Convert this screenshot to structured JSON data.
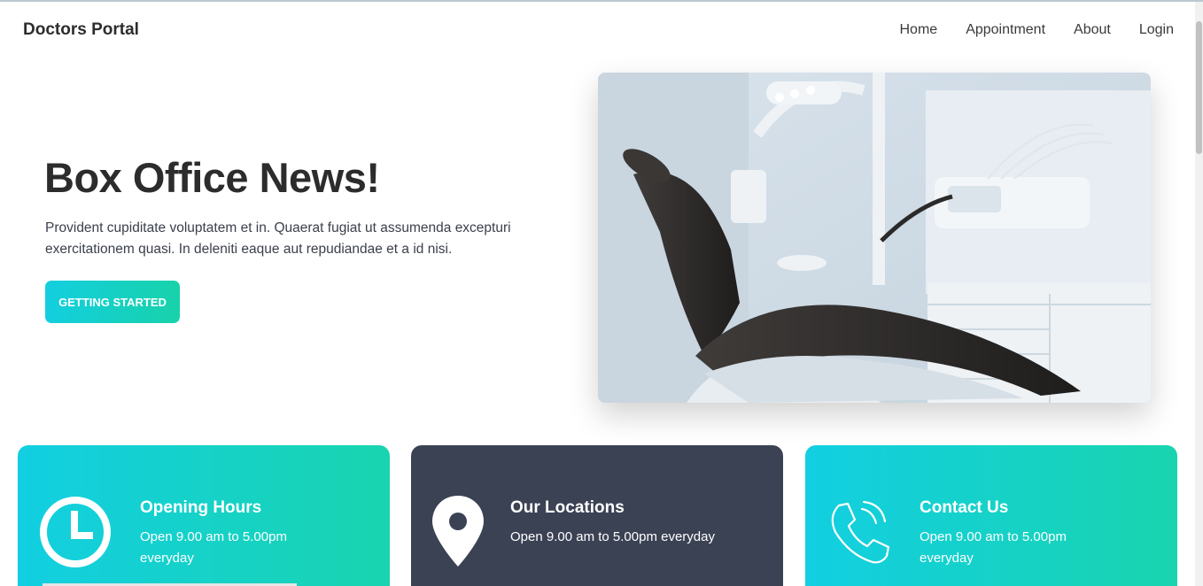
{
  "navbar": {
    "brand": "Doctors Portal",
    "links": [
      "Home",
      "Appointment",
      "About",
      "Login"
    ]
  },
  "hero": {
    "title": "Box Office News!",
    "description": "Provident cupiditate voluptatem et in. Quaerat fugiat ut assumenda excepturi exercitationem quasi. In deleniti eaque aut repudiandae et a id nisi.",
    "cta_label": "GETTING STARTED"
  },
  "cards": [
    {
      "title": "Opening Hours",
      "text": "Open 9.00 am to 5.00pm everyday",
      "icon": "clock-icon"
    },
    {
      "title": "Our Locations",
      "text": "Open 9.00 am to 5.00pm everyday",
      "icon": "location-pin-icon"
    },
    {
      "title": "Contact Us",
      "text": "Open 9.00 am to 5.00pm everyday",
      "icon": "phone-icon"
    }
  ],
  "colors": {
    "accent_start": "#13cfe0",
    "accent_end": "#18d2aa",
    "dark_card": "#3b4254"
  }
}
